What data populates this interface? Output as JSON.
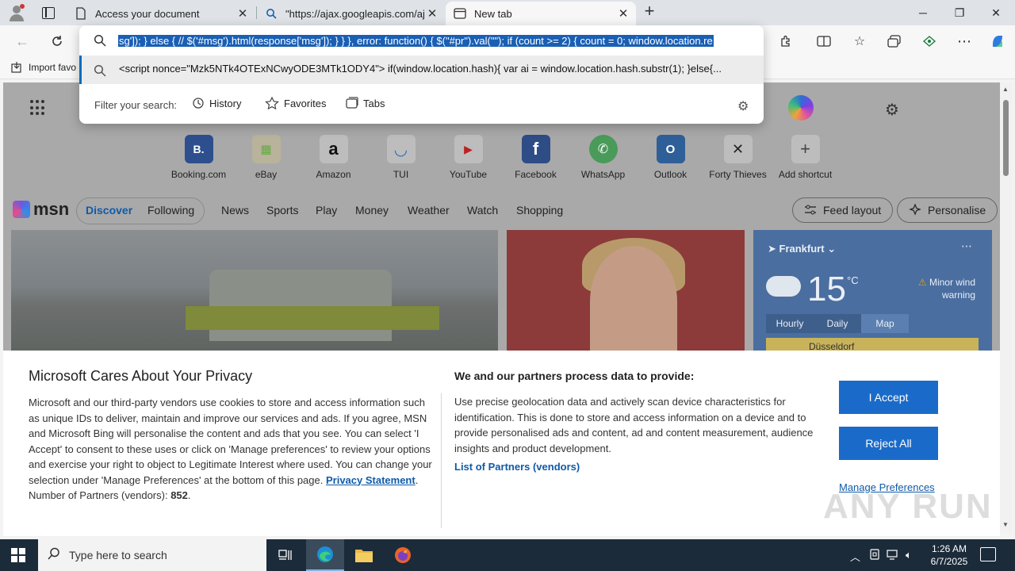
{
  "browser": {
    "tabs": [
      {
        "title": "Access your document"
      },
      {
        "title": "\"https://ajax.googleapis.com/aja"
      },
      {
        "title": "New tab"
      }
    ],
    "window_controls": {
      "minimize": "─",
      "maximize": "❐",
      "close": "✕"
    }
  },
  "omnibox": {
    "selected_text": "sg']); } else { // $('#msg').html(response['msg']); } } }, error: function() { $(\"#pr\").val(\"\"); if (count >= 2) { count = 0; window.location.re",
    "suggestion": "<script nonce=\"Mzk5NTk4OTExNCwyODE3MTk1ODY4\"> if(window.location.hash){ var ai = window.location.hash.substr(1); }else{...",
    "filter_label": "Filter your search:",
    "filters": [
      "History",
      "Favorites",
      "Tabs"
    ]
  },
  "favorites_bar": {
    "import_label": "Import favo"
  },
  "shortcuts": [
    {
      "label": "Booking.com",
      "glyph": "B."
    },
    {
      "label": "eBay",
      "glyph": "▦"
    },
    {
      "label": "Amazon",
      "glyph": "a"
    },
    {
      "label": "TUI",
      "glyph": "◡"
    },
    {
      "label": "YouTube",
      "glyph": "▶"
    },
    {
      "label": "Facebook",
      "glyph": "f"
    },
    {
      "label": "WhatsApp",
      "glyph": "✆"
    },
    {
      "label": "Outlook",
      "glyph": "O"
    },
    {
      "label": "Forty Thieves",
      "glyph": "✕"
    },
    {
      "label": "Add shortcut",
      "glyph": "+"
    }
  ],
  "msn": {
    "logo": "msn",
    "nav": [
      "Discover",
      "Following",
      "News",
      "Sports",
      "Play",
      "Money",
      "Weather",
      "Watch",
      "Shopping"
    ],
    "feed_layout": "Feed layout",
    "personalise": "Personalise"
  },
  "weather": {
    "location": "Frankfurt",
    "temp": "15",
    "unit": "°C",
    "warning": "Minor wind warning",
    "tabs": [
      "Hourly",
      "Daily",
      "Map"
    ],
    "map_label": "Düsseldorf"
  },
  "privacy": {
    "title": "Microsoft Cares About Your Privacy",
    "body": "Microsoft and our third-party vendors use cookies to store and access information such as unique IDs to deliver, maintain and improve our services and ads. If you agree, MSN and Microsoft Bing will personalise the content and ads that you see. You can select 'I Accept' to consent to these uses or click on 'Manage preferences' to review your options and exercise your right to object to Legitimate Interest where used. You can change your selection under 'Manage Preferences' at the bottom of this page.",
    "privacy_link": "Privacy Statement",
    "partners_count_label": "Number of Partners (vendors):",
    "partners_count": "852",
    "subheading": "We and our partners process data to provide:",
    "purposes": "Use precise geolocation data and actively scan device characteristics for identification. This is done to store and access information on a device and to provide personalised ads and content, ad and content measurement, audience insights and product development.",
    "partners_link": "List of Partners (vendors)",
    "accept": "I Accept",
    "reject": "Reject All",
    "manage": "Manage Preferences"
  },
  "watermark": "ANY RUN",
  "taskbar": {
    "search_placeholder": "Type here to search",
    "time": "1:26 AM",
    "date": "6/7/2025"
  }
}
